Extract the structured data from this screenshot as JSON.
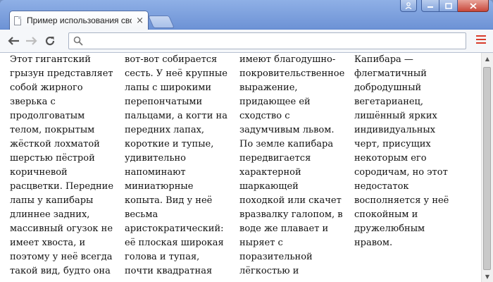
{
  "window": {
    "tab_title": "Пример использования сво",
    "tab_close": "×",
    "controls": {
      "minimize": "—",
      "maximize": "□",
      "close": "✕"
    }
  },
  "toolbar": {
    "back_icon": "arrow-left",
    "forward_icon": "arrow-right",
    "reload_icon": "reload",
    "address_value": "",
    "menu_icon": "hamburger-menu"
  },
  "content": {
    "columns": [
      "Этот гигантский грызун представляет собой жирного зверька с продолговатым телом, покрытым жёсткой лохматой шерстью пёстрой коричневой расцветки. Передние лапы у капибары длиннее задних, массивный огузок не имеет хвоста, и поэтому у неё всегда такой вид, будто она",
      "вот-вот собирается сесть. У неё крупные лапы с широкими перепончатыми пальцами, а когти на передних лапах, короткие и тупые, удивительно напоминают миниатюрные копыта. Вид у неё весьма аристократический: её плоская широкая голова и тупая, почти квадратная морда",
      "имеют благодушно-покровительственное выражение, придающее ей сходство с задумчивым львом. По земле капибара передвигается характерной шаркающей походкой или скачет вразвалку галопом, в воде же плавает и ныряет с поразительной лёгкостью и проворством.",
      "Капибара — флегматичный добродушный вегетарианец, лишённый ярких индивидуальных черт, присущих некоторым его сородичам, но этот недостаток восполняется у неё спокойным и дружелюбным нравом."
    ]
  },
  "colors": {
    "frame": "#6e93d6",
    "menu_accent": "#d83b2b",
    "close_button": "#c8473a"
  }
}
